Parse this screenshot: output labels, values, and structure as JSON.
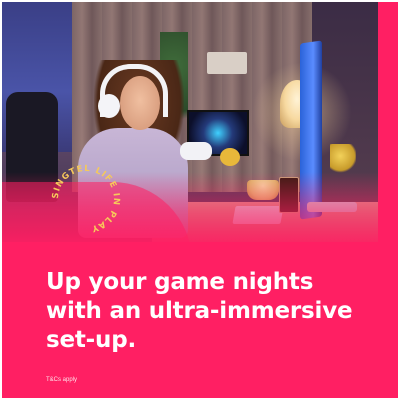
{
  "ad": {
    "headline_lines": [
      "Up your game nights",
      "with an ultra-immersive",
      "set-up."
    ],
    "terms": "T&Cs apply",
    "badge_text": "SINGTEL LIFE IN PLAY",
    "accent_color": "#ff1f63",
    "text_color": "#ffffff"
  }
}
